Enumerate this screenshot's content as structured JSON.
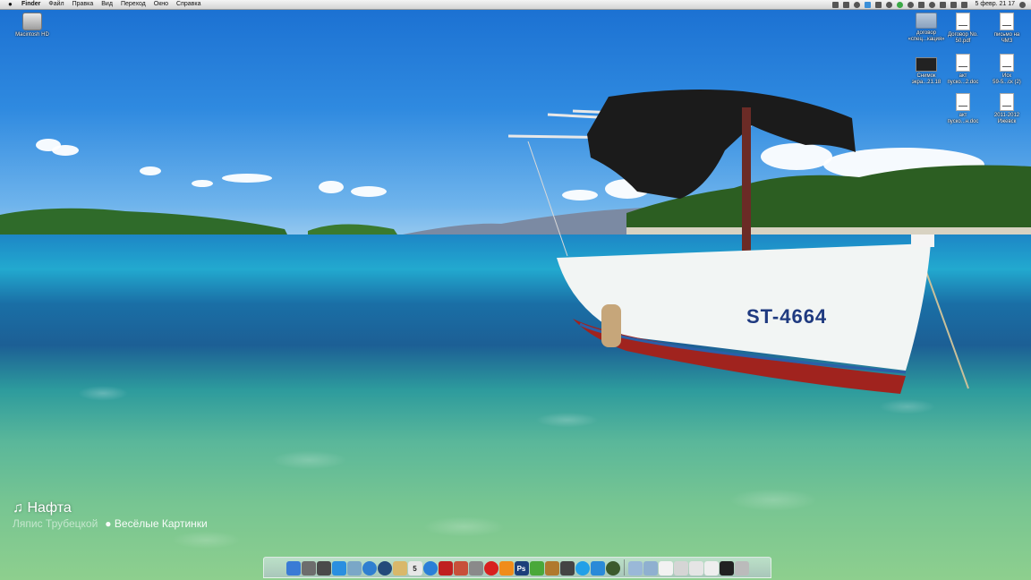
{
  "menubar": {
    "apple": "",
    "items": [
      "Finder",
      "Файл",
      "Правка",
      "Вид",
      "Переход",
      "Окно",
      "Справка"
    ],
    "clock": "5 февр. 21 17"
  },
  "desktop_icons": {
    "hd": "Macintosh HD",
    "folder": "договор\n«спец...кация»",
    "pdf": "Договор No.\n50.pdf",
    "letter": "письмо на\nЧМЗ",
    "screenshot": "Снимок\nэкра...21.18",
    "act1": "акт\nпуско...2.doc",
    "lawsuit": "Иск\n59-5...ск (2)",
    "act2": "акт\nпуско...н.doc",
    "period": "2011-2012\nИжевск"
  },
  "now_playing": {
    "note": "♫",
    "track": "Нафта",
    "artist": "Ляпис Трубецкой",
    "album": "Весёлые Картинки"
  },
  "boat": {
    "registration": "ST-4664"
  },
  "dock": {
    "apps": [
      {
        "icon": "finder-icon",
        "color": "#3a7bd5"
      },
      {
        "icon": "launchpad-icon",
        "color": "#6d6d6d"
      },
      {
        "icon": "mission-control-icon",
        "color": "#4a4a4a"
      },
      {
        "icon": "app-store-icon",
        "color": "#2a8fe0"
      },
      {
        "icon": "preview-icon",
        "color": "#7aa7c7"
      },
      {
        "icon": "safari-icon",
        "color": "#2f7fd0"
      },
      {
        "icon": "compass-icon",
        "color": "#244a7a"
      },
      {
        "icon": "notes-icon",
        "color": "#d9b86a"
      },
      {
        "icon": "calendar-icon",
        "color": "#e7e7e7"
      },
      {
        "icon": "itunes-icon",
        "color": "#2a7fd8"
      },
      {
        "icon": "flash-icon",
        "color": "#c02020"
      },
      {
        "icon": "photo-booth-icon",
        "color": "#c8503a"
      },
      {
        "icon": "settings-icon",
        "color": "#8a8a8a"
      },
      {
        "icon": "opera-icon",
        "color": "#d8201e"
      },
      {
        "icon": "vlc-icon",
        "color": "#f08c1a"
      },
      {
        "icon": "photoshop-icon",
        "color": "#1c3f7a"
      },
      {
        "icon": "flower-icon",
        "color": "#4aa83a"
      },
      {
        "icon": "suitcase-icon",
        "color": "#b0792e"
      },
      {
        "icon": "camera-icon",
        "color": "#444"
      },
      {
        "icon": "skype-icon",
        "color": "#22a0e8"
      },
      {
        "icon": "twitter-icon",
        "color": "#2a8ad8"
      },
      {
        "icon": "activity-icon",
        "color": "#3c5a2c"
      },
      {
        "icon": "folder-icon",
        "color": "#9ab8d8"
      },
      {
        "icon": "network-icon",
        "color": "#8fb0d0"
      },
      {
        "icon": "document-icon",
        "color": "#f2f2f2"
      },
      {
        "icon": "screen-icon",
        "color": "#d5d5d5"
      },
      {
        "icon": "window-icon",
        "color": "#e5e5e5"
      },
      {
        "icon": "pdf-icon",
        "color": "#eee"
      },
      {
        "icon": "terminal-icon",
        "color": "#222"
      },
      {
        "icon": "trash-icon",
        "color": "#bbb"
      }
    ],
    "labels": {
      "photoshop": "Ps",
      "calendar": "5"
    }
  }
}
